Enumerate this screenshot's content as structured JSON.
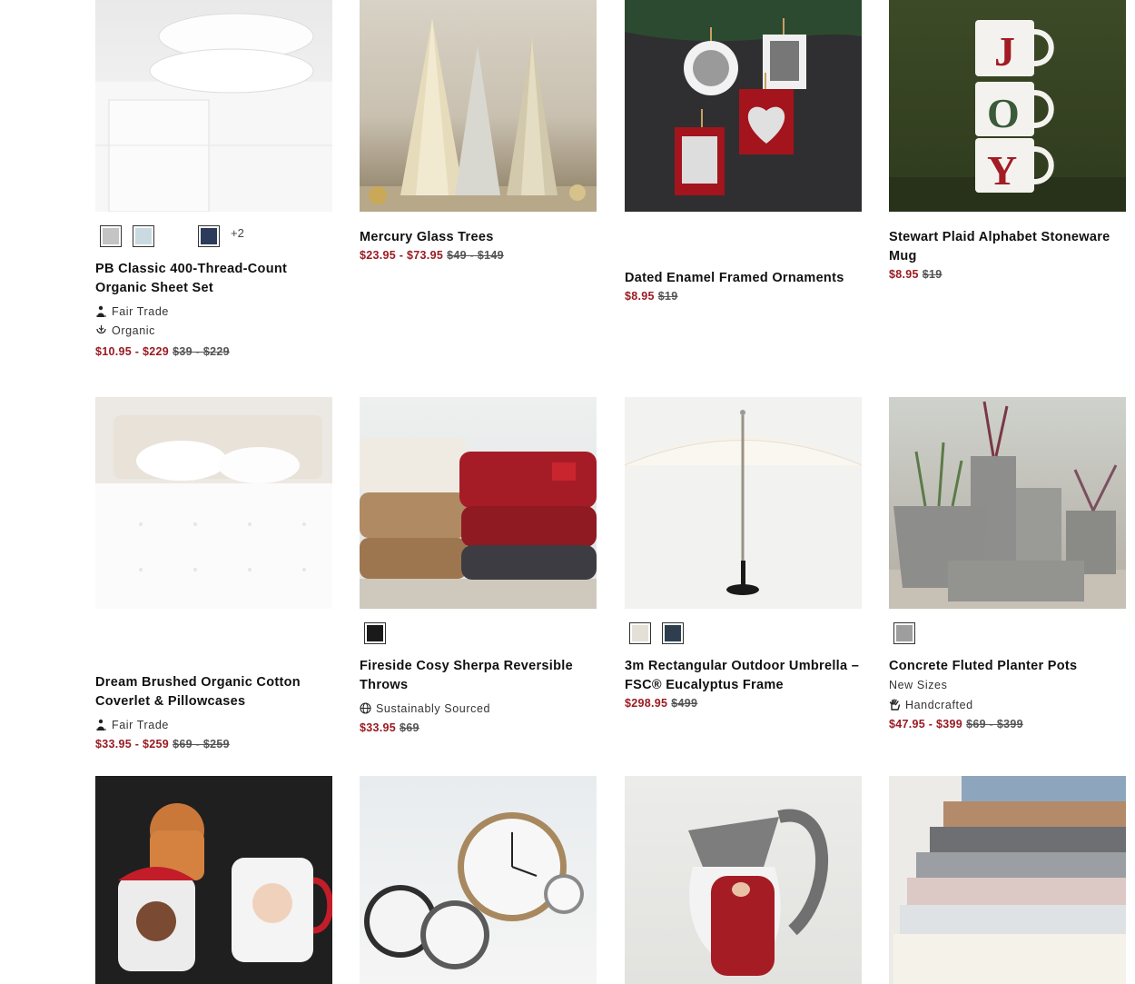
{
  "colors": {
    "sale_price": "#9b1b22",
    "orig_price": "#555555",
    "title": "#111111"
  },
  "products": [
    {
      "title": "PB Classic 400-Thread-Count Organic Sheet Set",
      "swatches": [
        "#c8c8c8",
        "#c9dbe0",
        "#ffffff",
        "#2c3a5c"
      ],
      "more_label": "+2",
      "badges": [
        {
          "icon": "fair-trade-icon",
          "label": "Fair Trade"
        },
        {
          "icon": "organic-icon",
          "label": "Organic"
        }
      ],
      "sale_price": "$10.95 - $229",
      "original_price": "$39 - $229"
    },
    {
      "title": "Mercury Glass Trees",
      "sale_price": "$23.95 - $73.95",
      "original_price": "$49 - $149"
    },
    {
      "title": "Dated Enamel Framed Ornaments",
      "sale_price": "$8.95",
      "original_price": "$19"
    },
    {
      "title": "Stewart Plaid Alphabet Stoneware Mug",
      "sale_price": "$8.95",
      "original_price": "$19"
    },
    {
      "title": "Dream Brushed Organic Cotton Coverlet & Pillowcases",
      "badges": [
        {
          "icon": "fair-trade-icon",
          "label": "Fair Trade"
        }
      ],
      "sale_price": "$33.95 - $259",
      "original_price": "$69 - $259"
    },
    {
      "title": "Fireside Cosy Sherpa Reversible Throws",
      "swatches": [
        "#1a1a1a"
      ],
      "badges": [
        {
          "icon": "globe-icon",
          "label": "Sustainably Sourced"
        }
      ],
      "sale_price": "$33.95",
      "original_price": "$69"
    },
    {
      "title": "3m Rectangular Outdoor Umbrella – FSC® Eucalyptus Frame",
      "swatches": [
        "#e5e0d6",
        "#2e3e4e"
      ],
      "sale_price": "$298.95",
      "original_price": "$499"
    },
    {
      "title": "Concrete Fluted Planter Pots",
      "swatches": [
        "#9e9e9e"
      ],
      "note": "New Sizes",
      "badges": [
        {
          "icon": "hand-icon",
          "label": "Handcrafted"
        }
      ],
      "sale_price": "$47.95 - $399",
      "original_price": "$69 - $399"
    }
  ]
}
